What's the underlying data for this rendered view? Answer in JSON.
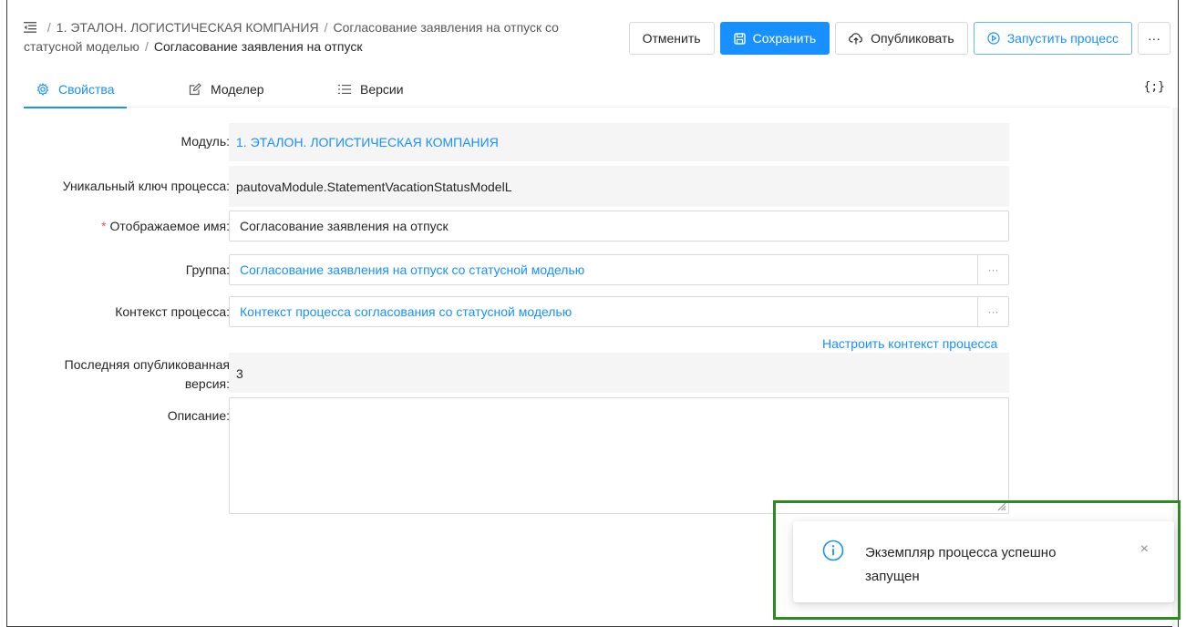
{
  "header": {
    "breadcrumb": {
      "part1": "1. ЭТАЛОН. ЛОГИСТИЧЕСКАЯ КОМПАНИЯ",
      "part2": "Согласование заявления на отпуск со статусной моделью",
      "current": "Согласование заявления на отпуск",
      "separator": "/"
    }
  },
  "toolbar": {
    "cancel_label": "Отменить",
    "save_label": "Сохранить",
    "publish_label": "Опубликовать",
    "start_label": "Запустить процесс",
    "more_label": "···"
  },
  "tabs": {
    "properties": "Свойства",
    "modeler": "Моделер",
    "versions": "Версии",
    "json": "{;}"
  },
  "form": {
    "module": {
      "label": "Модуль:",
      "value": "1. ЭТАЛОН. ЛОГИСТИЧЕСКАЯ КОМПАНИЯ"
    },
    "key": {
      "label": "Уникальный ключ процесса:",
      "value": "pautovaModule.StatementVacationStatusModelL"
    },
    "display_name": {
      "required_mark": "*",
      "label": "Отображаемое имя:",
      "value": "Согласование заявления на отпуск"
    },
    "group": {
      "label": "Группа:",
      "value": "Согласование заявления на отпуск со статусной моделью",
      "button": "···"
    },
    "context": {
      "label": "Контекст процесса:",
      "value": "Контекст процесса согласования со статусной моделью",
      "button": "···"
    },
    "configure_context": "Настроить контекст процесса",
    "last_version": {
      "label_line1": "Последняя опубликованная",
      "label_line2": "версия:",
      "value": "3"
    },
    "description": {
      "label": "Описание:",
      "value": ""
    }
  },
  "notification": {
    "message": "Экземпляр процесса успешно запущен",
    "close": "×"
  },
  "colors": {
    "accent": "#1890ff",
    "highlight": "#2e8b21",
    "required": "#ff4d4f"
  }
}
